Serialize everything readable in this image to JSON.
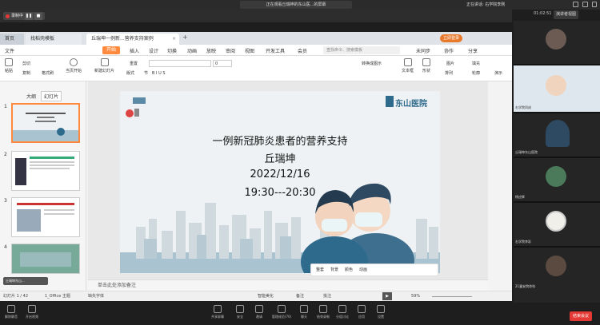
{
  "meeting": {
    "title": "正在观看丘瑞坤的东山医...的屏幕",
    "speaking": "正在讲话: 右学院李刚",
    "recording": "录制中",
    "time": "01:02:51",
    "gallery": "演讲者视图"
  },
  "wps": {
    "tabs": {
      "home": "首页",
      "t1": "找稻壳模板",
      "t2": "丘瑞坤一例新...营养支持案例"
    },
    "login": "立即登录",
    "menu": [
      "文件",
      "开始",
      "插入",
      "设计",
      "切换",
      "动画",
      "放映",
      "审阅",
      "视图",
      "开发工具",
      "会员"
    ],
    "search": "查找命令、搜索模板",
    "right_menu": [
      "未同步",
      "协作",
      "分享"
    ],
    "ribbon": {
      "paste": "粘贴",
      "cut": "剪切",
      "copy": "复制",
      "format": "格式刷",
      "play": "当页开始",
      "new_slide": "新建幻灯片",
      "layout": "版式",
      "section": "节",
      "reset": "重置",
      "font": "",
      "size": "0",
      "convert": "转换成图示",
      "textbox": "文本框",
      "shape": "形状",
      "arrange": "排列",
      "picture": "图片",
      "fill": "填充",
      "outline": "轮廓",
      "play2": "演示"
    },
    "side": {
      "outline": "大纲",
      "slides": "幻灯片",
      "nums": [
        "1",
        "2",
        "3",
        "4"
      ]
    },
    "slide": {
      "title": "一例新冠肺炎患者的营养支持",
      "author": "丘瑞坤",
      "date": "2022/12/16",
      "time": "19:30---20:30",
      "hospital": "东山医院"
    },
    "floating": [
      "整套",
      "背景",
      "颜色",
      "动画"
    ],
    "notes": "单击此处添加备注",
    "status": {
      "slide_count": "幻灯片 1 / 42",
      "theme": "1_Office 主题",
      "font_missing": "缺失字体",
      "smart": "智能美化",
      "notes": "备注",
      "comment": "批注",
      "zoom": "59%"
    }
  },
  "participants": [
    {
      "name": ""
    },
    {
      "name": "右学院同成"
    },
    {
      "name": "丘瑞坤东山医院"
    },
    {
      "name": ""
    },
    {
      "name": "杨应辉"
    },
    {
      "name": "右学院李彩"
    },
    {
      "name": "21童安院徐怡"
    },
    {
      "name": ""
    }
  ],
  "bottom": {
    "left": [
      "解除静音",
      "开启视频"
    ],
    "center": [
      "共享屏幕",
      "安全",
      "邀请",
      "管理成员(70)",
      "聊天",
      "结束录制",
      "分组讨论",
      "应用",
      "设置"
    ],
    "end": "结束会议"
  }
}
